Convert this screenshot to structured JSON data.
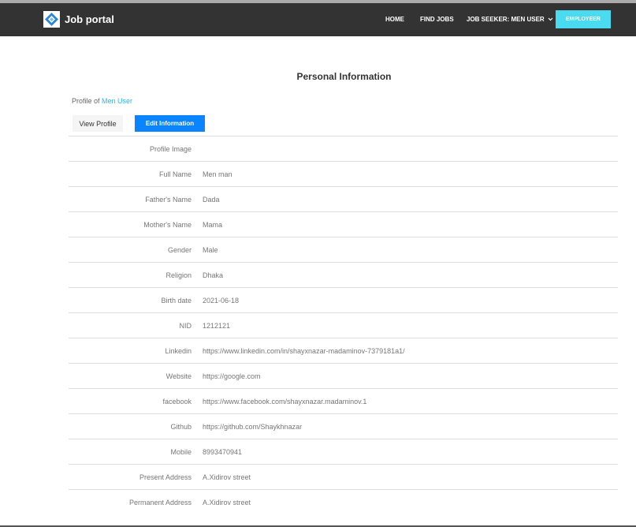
{
  "header": {
    "brand": "Job portal",
    "nav": {
      "home": "HOME",
      "find_jobs": "FIND JOBS",
      "job_seeker": "JOB SEEKER: MEN USER",
      "employer": "EMPLOYEER"
    }
  },
  "page_title": "Personal Information",
  "profile_of": {
    "prefix": "Profile of",
    "user": "Men User"
  },
  "buttons": {
    "view_profile": "View Profile",
    "edit_information": "Edit Information"
  },
  "fields": [
    {
      "label": "Profile Image",
      "value": ""
    },
    {
      "label": "Full Name",
      "value": "Men man"
    },
    {
      "label": "Father's Name",
      "value": "Dada"
    },
    {
      "label": "Mother's Name",
      "value": "Mama"
    },
    {
      "label": "Gender",
      "value": "Male"
    },
    {
      "label": "Religion",
      "value": "Dhaka"
    },
    {
      "label": "Birth date",
      "value": "2021-06-18"
    },
    {
      "label": "NID",
      "value": "1212121"
    },
    {
      "label": "Linkedin",
      "value": "https://www.linkedin.com/in/shayxnazar-madaminov-7379181a1/"
    },
    {
      "label": "Website",
      "value": "https://google.com"
    },
    {
      "label": "facebook",
      "value": "https://www.facebook.com/shayxnazar.madaminov.1"
    },
    {
      "label": "Github",
      "value": "https://github.com/Shaykhnazar"
    },
    {
      "label": "Mobile",
      "value": "8993470941"
    },
    {
      "label": "Present Address",
      "value": "A.Xidirov street"
    },
    {
      "label": "Permanent Address",
      "value": "A.Xidirov street"
    }
  ]
}
